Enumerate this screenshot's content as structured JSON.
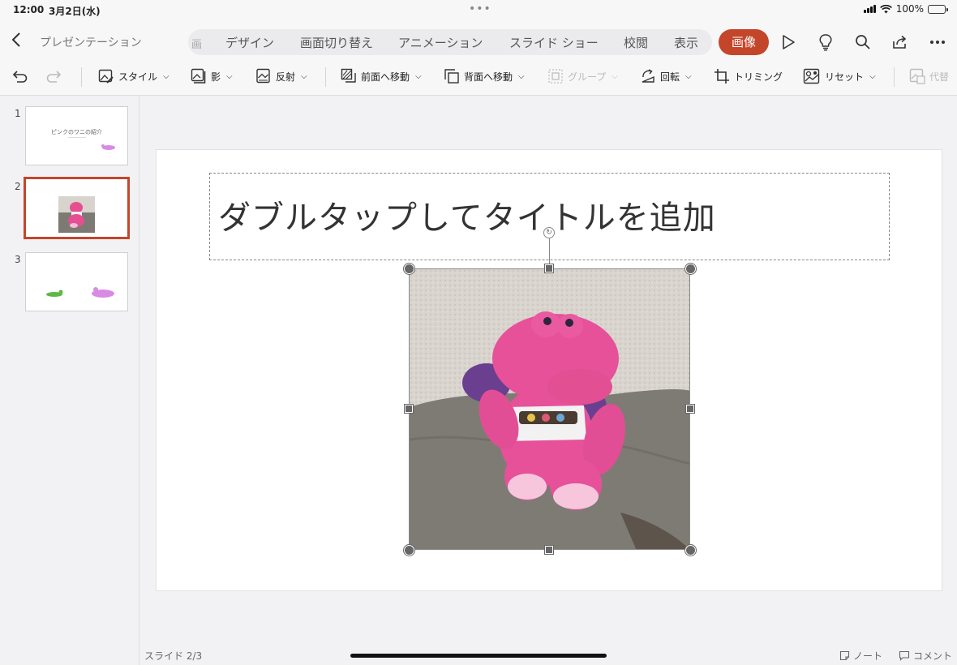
{
  "status": {
    "time": "12:00",
    "date": "3月2日(水)",
    "dots": "•••",
    "battery": "100%"
  },
  "header": {
    "back_icon": "chevron-left-icon",
    "doc_title": "プレゼンテーション",
    "cut_tab": "画",
    "tabs": [
      "デザイン",
      "画面切り替え",
      "アニメーション",
      "スライド ショー",
      "校閲",
      "表示"
    ],
    "active_tab": "画像",
    "icons": [
      "play-icon",
      "lightbulb-icon",
      "search-icon",
      "share-icon",
      "more-icon"
    ]
  },
  "commands": {
    "style": "スタイル",
    "shadow": "影",
    "reflection": "反射",
    "bring_forward": "前面へ移動",
    "send_backward": "背面へ移動",
    "group": "グループ",
    "rotate": "回転",
    "crop": "トリミング",
    "reset": "リセット",
    "alt_text": "代替"
  },
  "slides": [
    {
      "number": "1",
      "title": "ピンクのワニの紹介"
    },
    {
      "number": "2"
    },
    {
      "number": "3"
    }
  ],
  "slide": {
    "title_placeholder": "ダブルタップしてタイトルを追加"
  },
  "footer": {
    "slide_counter": "スライド 2/3",
    "notes": "ノート",
    "comments": "コメント"
  },
  "colors": {
    "accent": "#c4462a"
  }
}
